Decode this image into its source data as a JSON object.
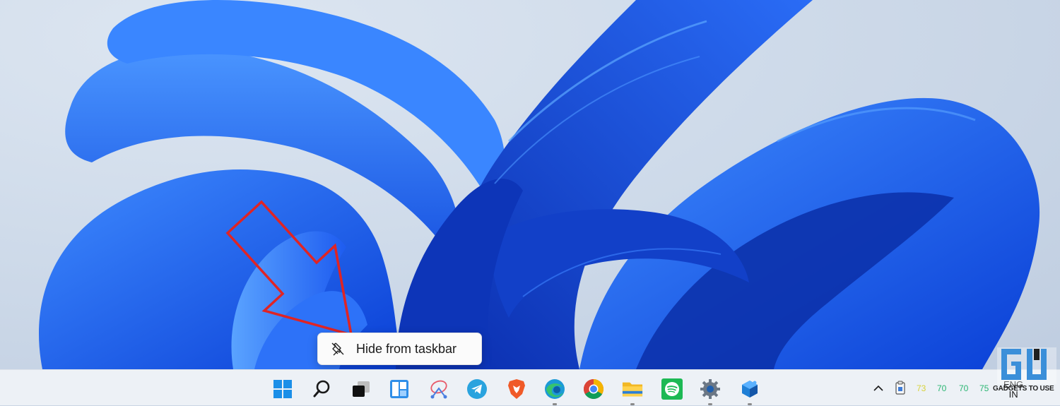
{
  "context_menu": {
    "items": [
      {
        "label": "Hide from taskbar",
        "icon": "unpin-icon"
      }
    ]
  },
  "taskbar": {
    "apps": [
      {
        "name": "start",
        "icon": "windows-start-icon"
      },
      {
        "name": "search",
        "icon": "search-icon"
      },
      {
        "name": "task-view",
        "icon": "task-view-icon"
      },
      {
        "name": "widgets",
        "icon": "widgets-icon"
      },
      {
        "name": "snipping",
        "icon": "snipping-tool-icon"
      },
      {
        "name": "telegram",
        "icon": "telegram-icon"
      },
      {
        "name": "brave",
        "icon": "brave-icon"
      },
      {
        "name": "edge",
        "icon": "edge-icon"
      },
      {
        "name": "chrome",
        "icon": "chrome-icon"
      },
      {
        "name": "file-explorer",
        "icon": "folder-icon"
      },
      {
        "name": "spotify",
        "icon": "spotify-icon"
      },
      {
        "name": "settings",
        "icon": "gear-icon"
      },
      {
        "name": "app",
        "icon": "cube-app-icon"
      }
    ],
    "tray": {
      "chevron": "chevron-up-icon",
      "clipboard": "clipboard-icon",
      "numbers": [
        "73",
        "70",
        "70",
        "75"
      ],
      "number_colors": [
        "#d8d23a",
        "#2bb673",
        "#2bb673",
        "#2bb673"
      ],
      "language": {
        "line1": "ENG",
        "line2": "IN"
      }
    }
  },
  "watermark": {
    "text": "GADGETS TO USE",
    "logo": "gadgets-to-use-logo"
  },
  "colors": {
    "annotation": "#e02424",
    "accent": "#0f6cbd"
  }
}
